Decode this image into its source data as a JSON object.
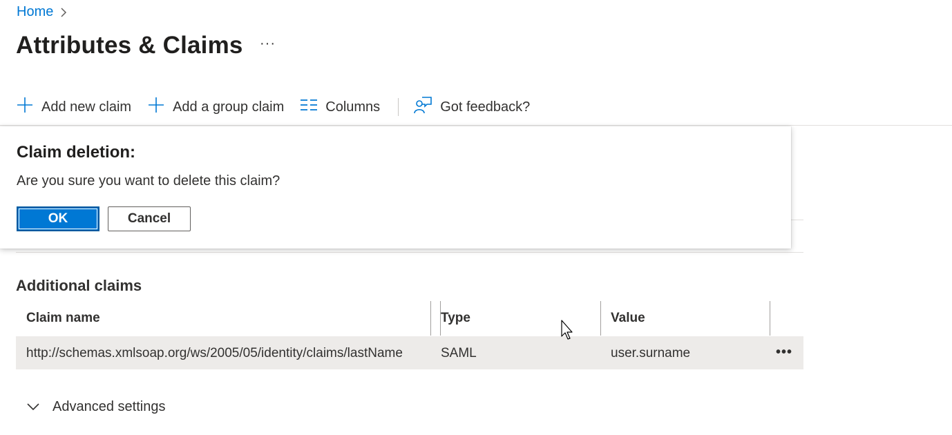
{
  "breadcrumb": {
    "home": "Home"
  },
  "header": {
    "title": "Attributes & Claims",
    "more": "···"
  },
  "toolbar": {
    "add_new_claim": "Add new claim",
    "add_group_claim": "Add a group claim",
    "columns": "Columns",
    "feedback": "Got feedback?"
  },
  "additional_claims": {
    "title": "Additional claims",
    "columns": {
      "claim_name": "Claim name",
      "type": "Type",
      "value": "Value"
    },
    "rows": [
      {
        "claim_name": "http://schemas.xmlsoap.org/ws/2005/05/identity/claims/lastName",
        "type": "SAML",
        "value": "user.surname",
        "more": "•••"
      }
    ]
  },
  "advanced_settings": {
    "label": "Advanced settings"
  },
  "dialog": {
    "title": "Claim deletion:",
    "message": "Are you sure you want to delete this claim?",
    "ok": "OK",
    "cancel": "Cancel"
  },
  "colors": {
    "accent": "#0078d4",
    "row_bg": "#edebe9",
    "text": "#323130"
  },
  "icons": [
    "chevron-right-icon",
    "plus-icon",
    "columns-icon",
    "feedback-icon",
    "chevron-down-icon",
    "mouse-pointer-icon"
  ]
}
